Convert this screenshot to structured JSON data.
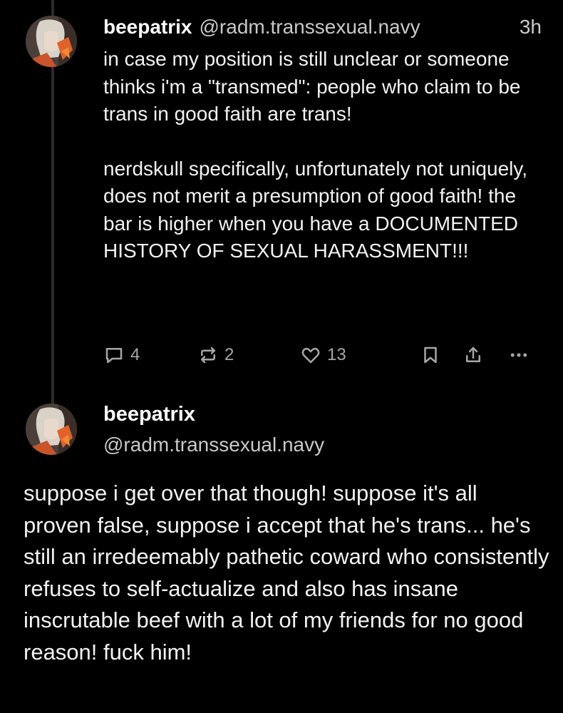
{
  "post1": {
    "display_name": "beepatrix",
    "handle": "@radm.transsexual.navy",
    "timestamp": "3h",
    "paragraphs": [
      "in case my position is still unclear or someone thinks i'm a \"transmed\": people who claim to be trans in good faith are trans!",
      "nerdskull specifically, unfortunately not uniquely, does not merit a presumption of good faith! the bar is higher when you have a DOCUMENTED HISTORY OF SEXUAL HARASSMENT!!!"
    ],
    "actions": {
      "replies": "4",
      "reposts": "2",
      "likes": "13"
    }
  },
  "post2": {
    "display_name": "beepatrix",
    "handle": "@radm.transsexual.navy",
    "body": "suppose i get over that though! suppose it's all proven false, suppose i accept that he's trans... he's still an irredeemably pathetic coward who consistently refuses to self-actualize and also has insane inscrutable beef with a lot of my friends for no good reason! fuck him!"
  },
  "icons": {
    "reply": "reply-icon",
    "repost": "repost-icon",
    "like": "heart-icon",
    "bookmark": "bookmark-icon",
    "share": "share-icon",
    "more": "more-icon"
  },
  "colors": {
    "background": "#000000",
    "text": "#f2f2f2",
    "secondary_text": "#c9c9c9",
    "icon": "#a6a6a6",
    "thread_line": "#2b2b2b"
  }
}
